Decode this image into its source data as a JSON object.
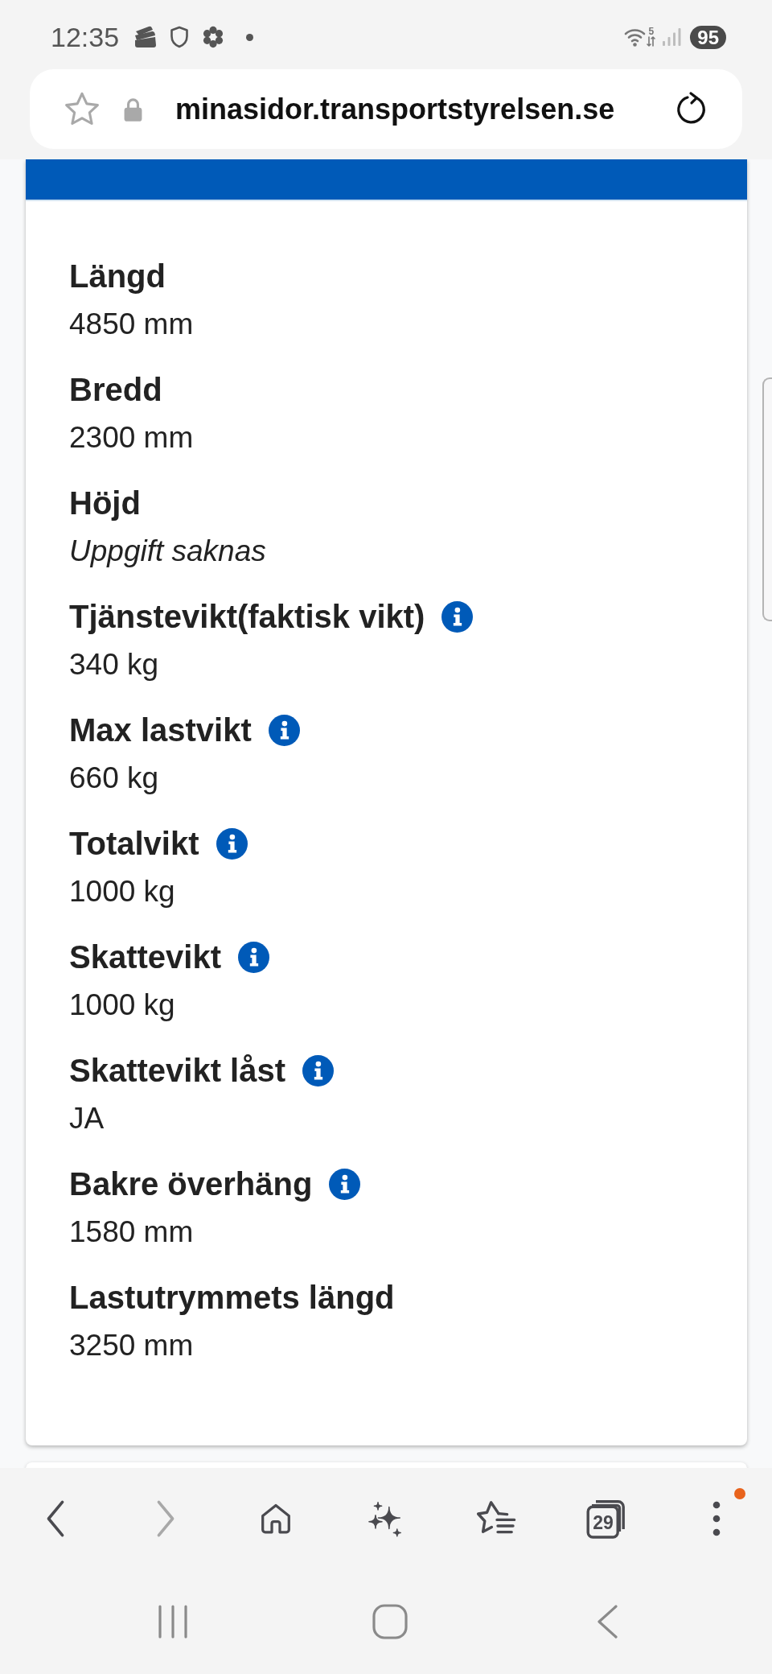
{
  "status_bar": {
    "time": "12:35",
    "wifi_label": "5",
    "battery": "95"
  },
  "address_bar": {
    "bookmarked": false,
    "url": "minasidor.transportstyrelsen.se"
  },
  "details_card": {
    "fields": [
      {
        "label": "Längd",
        "info": false,
        "value": "4850 mm",
        "missing": false
      },
      {
        "label": "Bredd",
        "info": false,
        "value": "2300 mm",
        "missing": false
      },
      {
        "label": "Höjd",
        "info": false,
        "value": "Uppgift saknas",
        "missing": true
      },
      {
        "label": "Tjänstevikt(faktisk vikt)",
        "info": true,
        "value": "340 kg",
        "missing": false
      },
      {
        "label": "Max lastvikt",
        "info": true,
        "value": "660 kg",
        "missing": false
      },
      {
        "label": "Totalvikt",
        "info": true,
        "value": "1000 kg",
        "missing": false
      },
      {
        "label": "Skattevikt",
        "info": true,
        "value": "1000 kg",
        "missing": false
      },
      {
        "label": "Skattevikt låst",
        "info": true,
        "value": "JA",
        "missing": false
      },
      {
        "label": "Bakre överhäng",
        "info": true,
        "value": "1580 mm",
        "missing": false
      },
      {
        "label": "Lastutrymmets längd",
        "info": false,
        "value": "3250 mm",
        "missing": false
      }
    ]
  },
  "toolbar": {
    "items": [
      {
        "kind": "back",
        "disabled": false,
        "notification": false
      },
      {
        "kind": "forward",
        "disabled": true,
        "notification": false
      },
      {
        "kind": "home",
        "disabled": false,
        "notification": false
      },
      {
        "kind": "assistant",
        "disabled": false,
        "notification": false
      },
      {
        "kind": "bookmarks",
        "disabled": false,
        "notification": false
      },
      {
        "kind": "tabs",
        "count": "29",
        "disabled": false,
        "notification": false
      },
      {
        "kind": "menu",
        "disabled": false,
        "notification": true
      }
    ]
  },
  "system_nav": {
    "items": [
      {
        "kind": "recents"
      },
      {
        "kind": "home"
      },
      {
        "kind": "back"
      }
    ]
  }
}
